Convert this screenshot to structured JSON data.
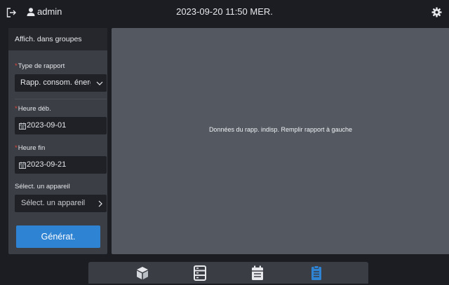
{
  "topbar": {
    "username": "admin",
    "datetime": "2023-09-20 11:50 MER.",
    "icons": [
      "logout-icon",
      "user-icon",
      "settings-icon"
    ]
  },
  "sidebar": {
    "header": "Affich. dans groupes",
    "report_type": {
      "label": "Type de rapport",
      "required": true,
      "value": "Rapp. consom. énergie"
    },
    "start_time": {
      "label": "Heure déb.",
      "required": true,
      "value": "2023-09-01"
    },
    "end_time": {
      "label": "Heure fin",
      "required": true,
      "value": "2023-09-21"
    },
    "device": {
      "label": "Sélect. un appareil",
      "value": "Sélect. un appareil"
    },
    "generate_label": "Générat."
  },
  "main": {
    "message": "Données du rapp. indisp. Remplir rapport à gauche"
  },
  "bottom_nav": {
    "items": [
      "device-icon",
      "list-icon",
      "calendar-icon",
      "report-icon"
    ],
    "active": "report-icon"
  },
  "colors": {
    "accent": "#2f83d3",
    "required": "#e0453b",
    "background": "#1b1d22",
    "panel": "#545961"
  }
}
